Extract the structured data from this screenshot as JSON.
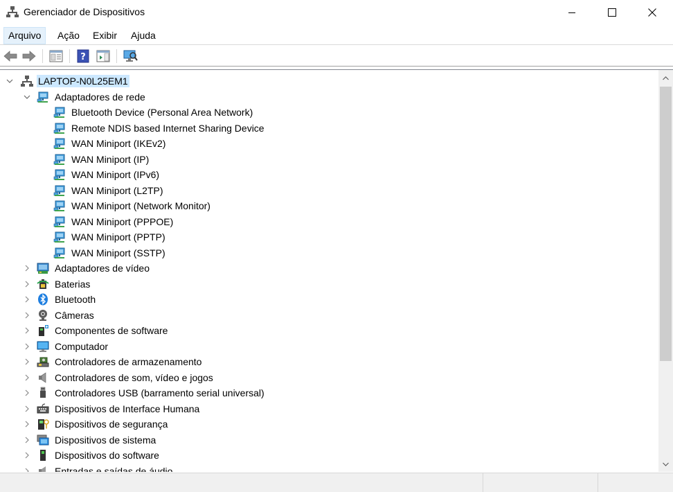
{
  "window": {
    "title": "Gerenciador de Dispositivos",
    "icons": {
      "app": "device-manager-icon",
      "minimize": "minimize-icon",
      "maximize": "maximize-icon",
      "close": "close-icon"
    }
  },
  "menu": {
    "items": [
      {
        "label": "Arquivo"
      },
      {
        "label": "Ação"
      },
      {
        "label": "Exibir"
      },
      {
        "label": "Ajuda"
      }
    ],
    "active": "Arquivo"
  },
  "toolbar": {
    "buttons": [
      "back-arrow-icon",
      "forward-arrow-icon",
      "properties-icon",
      "help-icon",
      "action-pane-icon",
      "scan-hardware-icon"
    ]
  },
  "tree": {
    "root": {
      "label": "LAPTOP-N0L25EM1",
      "expanded": true,
      "selected": true
    },
    "categories": [
      {
        "label": "Adaptadores de rede",
        "expanded": true,
        "icon": "network-adapter-icon",
        "children": [
          "Bluetooth Device (Personal Area Network)",
          "Remote NDIS based Internet Sharing Device",
          "WAN Miniport (IKEv2)",
          "WAN Miniport (IP)",
          "WAN Miniport (IPv6)",
          "WAN Miniport (L2TP)",
          "WAN Miniport (Network Monitor)",
          "WAN Miniport (PPPOE)",
          "WAN Miniport (PPTP)",
          "WAN Miniport (SSTP)"
        ]
      },
      {
        "label": "Adaptadores de vídeo",
        "expanded": false,
        "icon": "display-adapter-icon"
      },
      {
        "label": "Baterias",
        "expanded": false,
        "icon": "battery-icon"
      },
      {
        "label": "Bluetooth",
        "expanded": false,
        "icon": "bluetooth-icon"
      },
      {
        "label": "Câmeras",
        "expanded": false,
        "icon": "camera-icon"
      },
      {
        "label": "Componentes de software",
        "expanded": false,
        "icon": "software-component-icon"
      },
      {
        "label": "Computador",
        "expanded": false,
        "icon": "computer-icon"
      },
      {
        "label": "Controladores de armazenamento",
        "expanded": false,
        "icon": "storage-controller-icon"
      },
      {
        "label": "Controladores de som, vídeo e jogos",
        "expanded": false,
        "icon": "speaker-icon"
      },
      {
        "label": "Controladores USB (barramento serial universal)",
        "expanded": false,
        "icon": "usb-icon"
      },
      {
        "label": "Dispositivos de Interface Humana",
        "expanded": false,
        "icon": "hid-icon"
      },
      {
        "label": "Dispositivos de segurança",
        "expanded": false,
        "icon": "security-device-icon"
      },
      {
        "label": "Dispositivos de sistema",
        "expanded": false,
        "icon": "system-device-icon"
      },
      {
        "label": "Dispositivos do software",
        "expanded": false,
        "icon": "software-device-icon"
      },
      {
        "label": "Entradas e saídas de áudio",
        "expanded": false,
        "icon": "audio-io-icon"
      }
    ]
  },
  "colors": {
    "selection": "#cce8ff",
    "menu_active": "#e5f1fb",
    "scrollbar_track": "#f0f0f0",
    "scrollbar_thumb": "#cdcdcd"
  }
}
